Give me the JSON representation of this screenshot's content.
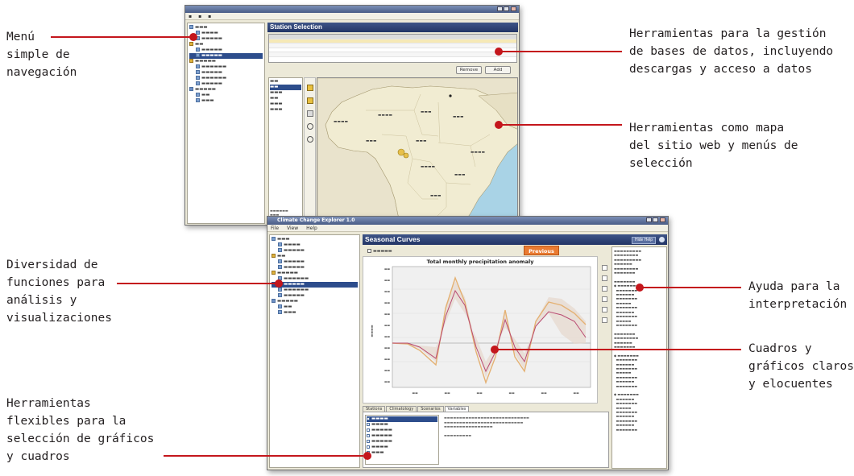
{
  "annotations": {
    "menu": "Menú\nsimple de\nnavegación",
    "db_tools": "Herramientas para la gestión\nde bases de datos, incluyendo\ndescargas y acceso a datos",
    "map_tools": "Herramientas como mapa\ndel sitio web y menús de\nselección",
    "functions": "Diversidad de\nfunciones para\nanálisis y\nvisualizaciones",
    "help": "Ayuda para la\ninterpretación",
    "charts": "Cuadros y\ngráficos claros\ny elocuentes",
    "flex_tools": "Herramientas\nflexibles para la\nselección de gráficos\ny cuadros"
  },
  "window1": {
    "panel_title": "Station Selection",
    "buttons": [
      "Remove",
      "Add"
    ]
  },
  "window2": {
    "title": "Climate Change Explorer 1.0",
    "menu": [
      "File",
      "View",
      "Help"
    ],
    "panel_title": "Seasonal Curves",
    "hide_help": "Hide Help",
    "previous": "Previous",
    "chart_title": "Total monthly precipitation anomaly",
    "tabs": [
      "Stations",
      "Climatology",
      "Scenarios",
      "Variables"
    ]
  },
  "chart_data": {
    "type": "line",
    "title": "Total monthly precipitation anomaly",
    "series_colors": [
      "#e4b173",
      "#b94a72"
    ]
  },
  "colors": {
    "accent": "#c4161c",
    "panel": "#2a3d70",
    "button_orange": "#ea7b32"
  }
}
